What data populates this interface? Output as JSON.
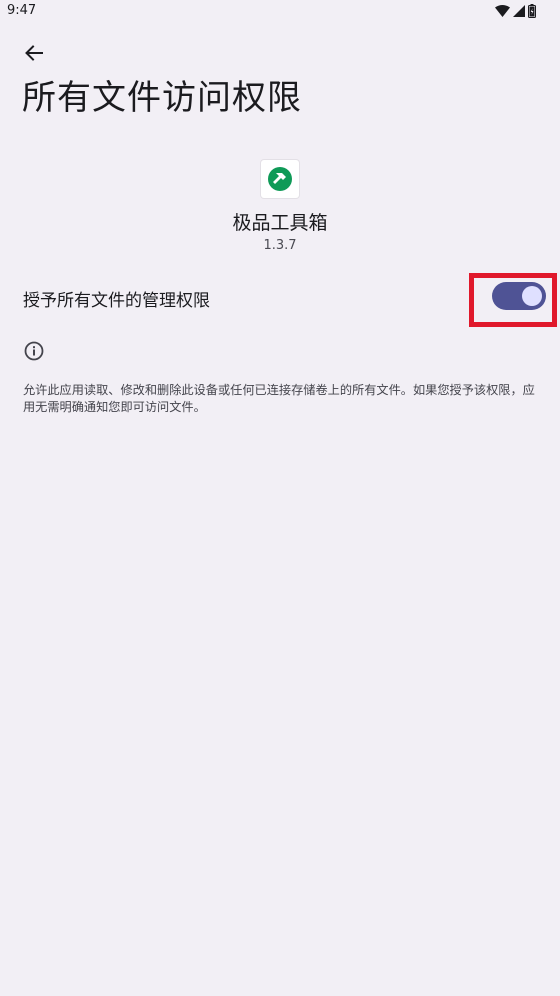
{
  "status_bar": {
    "time": "9:47",
    "icons": [
      "wifi-icon",
      "signal-icon",
      "battery-icon"
    ]
  },
  "header": {
    "back_icon": "arrow-left-icon",
    "title": "所有文件访问权限"
  },
  "app": {
    "icon": "hammer-icon",
    "name": "极品工具箱",
    "version": "1.3.7"
  },
  "permission": {
    "label": "授予所有文件的管理权限",
    "enabled": true
  },
  "info": {
    "icon": "info-icon",
    "description": "允许此应用读取、修改和删除此设备或任何已连接存储卷上的所有文件。如果您授予该权限，应用无需明确通知您即可访问文件。"
  },
  "colors": {
    "background": "#f2eff5",
    "switch_track": "#4f5395",
    "switch_thumb": "#dfe0ff",
    "app_icon_green": "#0f9a57",
    "highlight": "#e0182b"
  }
}
